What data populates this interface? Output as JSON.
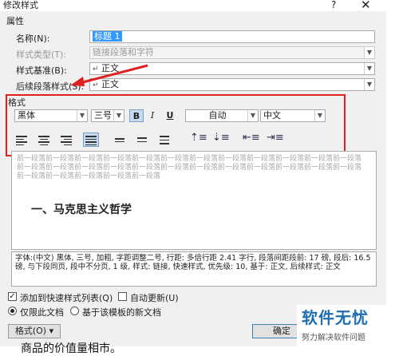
{
  "window": {
    "title": "修改样式",
    "help": "?",
    "close": "✕"
  },
  "properties": {
    "section": "属性",
    "name_label": "名称(N):",
    "name_value": "标题 1",
    "type_label": "样式类型(T):",
    "type_value": "链接段落和字符",
    "based_label": "样式基准(B):",
    "based_value": "正文",
    "based_icon": "↵",
    "following_label": "后续段落样式(S):",
    "following_value": "正文",
    "following_icon": "↵"
  },
  "format": {
    "section": "格式",
    "font": "黑体",
    "size": "三号",
    "bold": "B",
    "italic": "I",
    "underline": "U",
    "color": "自动",
    "lang": "中文"
  },
  "preview": {
    "prev_text": "前一段落前一段落前一段落前一段落前一段落前一段落前一段落前一段落前一段落前一段落前一段落前一段落前一段落前一段落前一段落前一段落前一段落前一段落前一段落前一段落前一段落前一段落前一段落前一段落前一段落前一段落前一段落前一段落前一段落",
    "heading": "一、马克思主义哲学"
  },
  "description": "字体:(中文) 黑体, 三号, 加粗, 字距调整二号, 行距: 多倍行距 2.41 字行, 段落间距段前: 17 磅, 段后: 16.5 磅, 与下段同页, 段中不分页, 1 级, 样式: 链接, 快速样式, 优先级: 10, 基于: 正文, 后续样式: 正文",
  "options": {
    "add_quick": "添加到快速样式列表(Q)",
    "add_quick_checked": true,
    "auto_update": "自动更新(U)",
    "auto_update_checked": false,
    "only_doc": "仅限此文档",
    "new_doc": "基于该模板的新文档"
  },
  "buttons": {
    "format": "格式(O) ▾",
    "ok": "确定"
  },
  "watermark": {
    "main": "软件无忧",
    "sub": "努力解决软件问题"
  },
  "background_text": "商品的价值量相市。",
  "colors": {
    "accent": "#3399ff",
    "highlight": "#e02020",
    "brand": "#1f6fb5"
  }
}
